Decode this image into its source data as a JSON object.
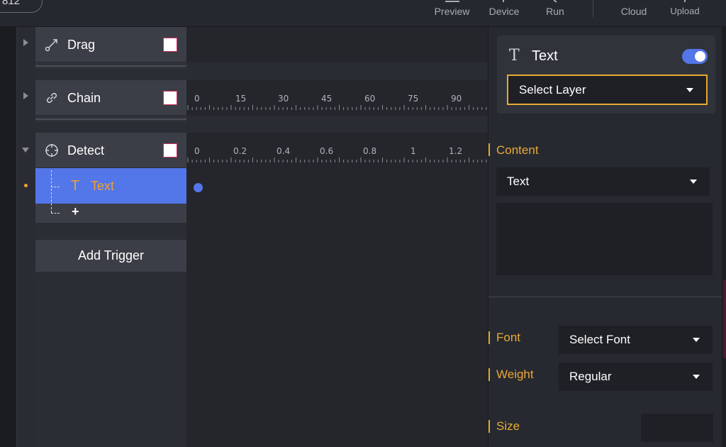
{
  "toolbar": {
    "zoom_label": "812",
    "preview_label": "Preview",
    "device_label": "Device",
    "run_label": "Run",
    "cloud_label": "Cloud",
    "upload_label": "Upload"
  },
  "triggers": [
    {
      "label": "Drag",
      "icon": "drag-icon",
      "expanded": false
    },
    {
      "label": "Chain",
      "icon": "chain-icon",
      "expanded": false
    },
    {
      "label": "Detect",
      "icon": "crosshair-icon",
      "expanded": true
    }
  ],
  "detect_child": {
    "label": "Text",
    "icon": "text-icon"
  },
  "add_trigger_label": "Add Trigger",
  "plus_label": "+",
  "rulers": {
    "chain": [
      "0",
      "15",
      "30",
      "45",
      "60",
      "75",
      "90"
    ],
    "detect": [
      "0",
      "0.2",
      "0.4",
      "0.6",
      "0.8",
      "1",
      "1.2"
    ]
  },
  "inspector": {
    "title": "Text",
    "enabled": true,
    "layer_select": "Select Layer",
    "content_label": "Content",
    "content_select": "Text",
    "font_label": "Font",
    "font_select": "Select Font",
    "weight_label": "Weight",
    "weight_select": "Regular",
    "size_label": "Size"
  },
  "colors": {
    "accent_blue": "#5376e8",
    "accent_orange": "#e8a935",
    "checkbox_border": "#d03060"
  }
}
